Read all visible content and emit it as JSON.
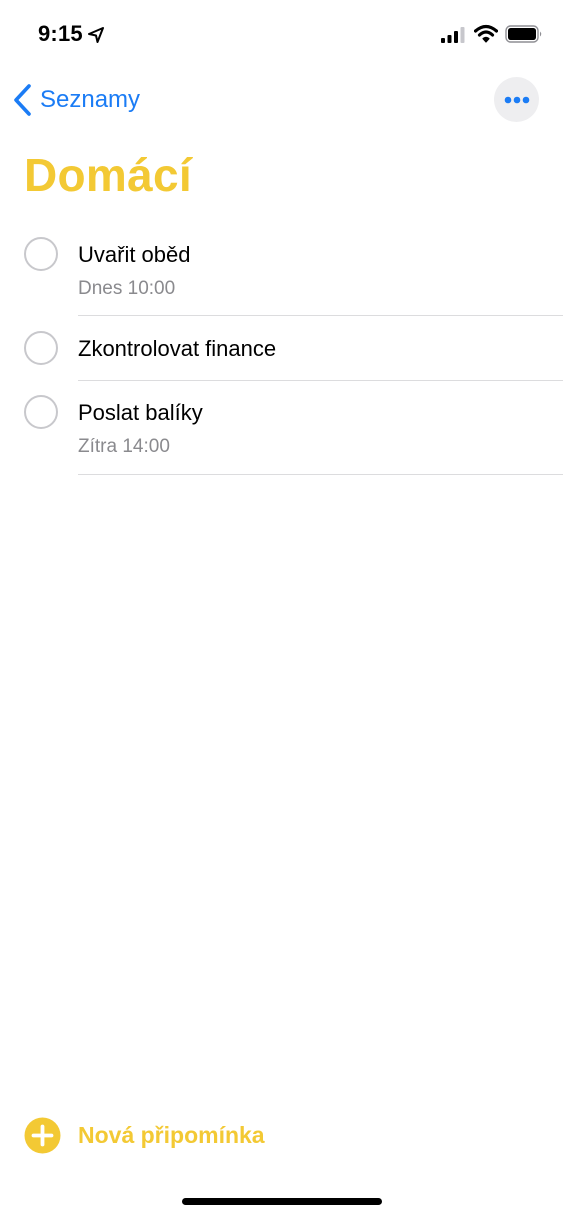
{
  "status_bar": {
    "time": "9:15",
    "icons": [
      "location-arrow-icon",
      "cellular-signal-icon",
      "wifi-icon",
      "battery-icon"
    ]
  },
  "nav": {
    "back_label": "Seznamy",
    "more_icon": "ellipsis-icon"
  },
  "list": {
    "title": "Domácí",
    "accent_color": "#f3c934",
    "link_color": "#1b7cf5"
  },
  "reminders": [
    {
      "title": "Uvařit oběd",
      "due": "Dnes 10:00"
    },
    {
      "title": "Zkontrolovat finance",
      "due": ""
    },
    {
      "title": "Poslat balíky",
      "due": "Zítra 14:00"
    }
  ],
  "footer": {
    "new_reminder_label": "Nová připomínka",
    "new_reminder_icon": "plus-circle-icon"
  }
}
